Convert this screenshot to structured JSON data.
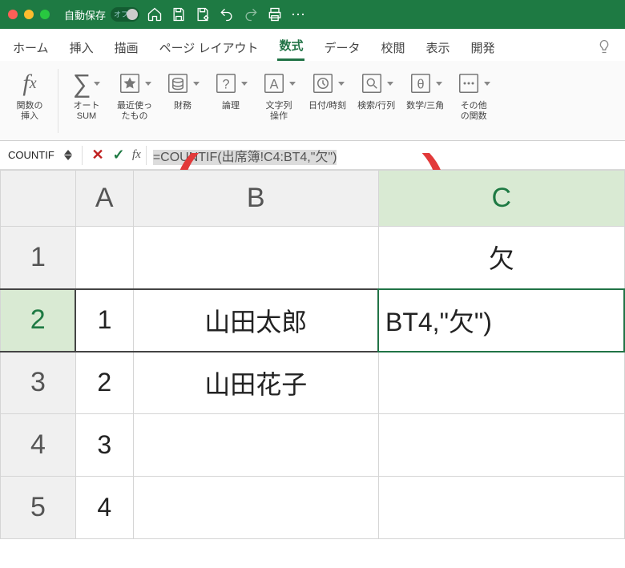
{
  "titlebar": {
    "autosave_label": "自動保存",
    "autosave_state": "オフ"
  },
  "tabs": {
    "items": [
      "ホーム",
      "挿入",
      "描画",
      "ページ レイアウト",
      "数式",
      "データ",
      "校閲",
      "表示",
      "開発"
    ],
    "active_index": 4
  },
  "ribbon": {
    "insert_function": "関数の\n挿入",
    "autosum": "オート\nSUM",
    "recent": "最近使っ\nたもの",
    "financial": "財務",
    "logical": "論理",
    "text": "文字列\n操作",
    "datetime": "日付/時刻",
    "lookup": "検索/行列",
    "math": "数学/三角",
    "more": "その他\nの関数"
  },
  "formula_bar": {
    "namebox": "COUNTIF",
    "fx_label": "fx",
    "formula": "=COUNTIF(出席簿!C4:BT4,\"欠\")"
  },
  "grid": {
    "columns": [
      "A",
      "B",
      "C"
    ],
    "rows": [
      {
        "n": "1",
        "A": "",
        "B": "",
        "C": "欠"
      },
      {
        "n": "2",
        "A": "1",
        "B": "山田太郎",
        "C": "BT4,\"欠\")"
      },
      {
        "n": "3",
        "A": "2",
        "B": "山田花子",
        "C": ""
      },
      {
        "n": "4",
        "A": "3",
        "B": "",
        "C": ""
      },
      {
        "n": "5",
        "A": "4",
        "B": "",
        "C": ""
      }
    ],
    "active_cell": "C2"
  }
}
